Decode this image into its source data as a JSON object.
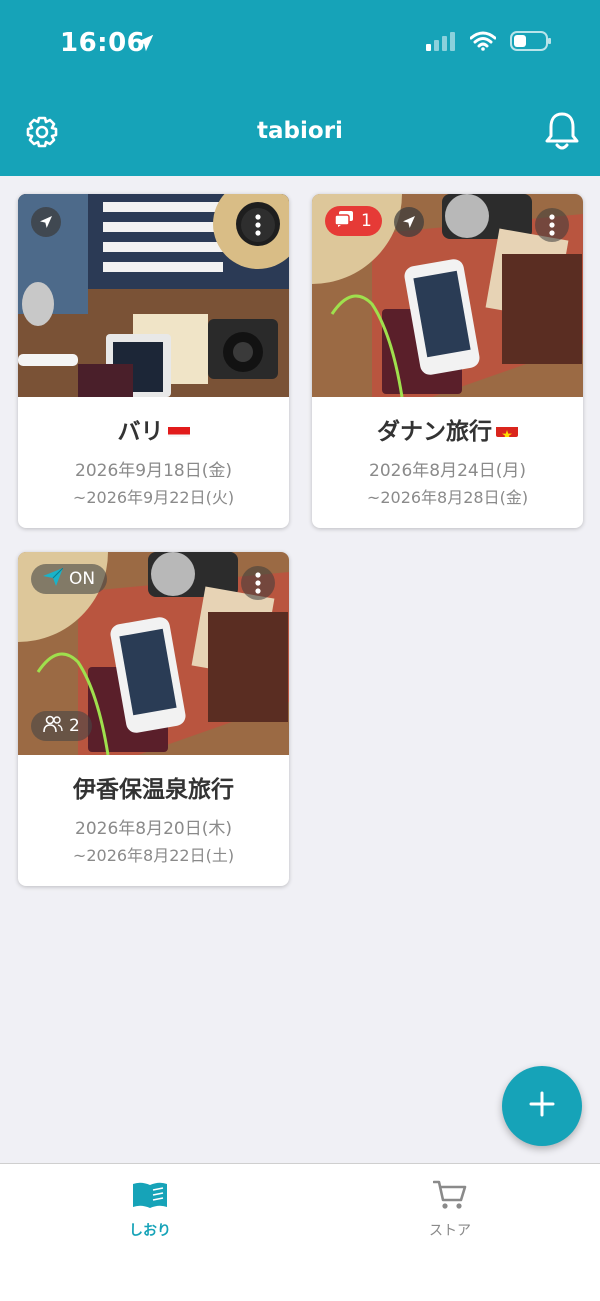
{
  "status": {
    "time": "16:06"
  },
  "header": {
    "title": "tabiori"
  },
  "trips": [
    {
      "title": "バリ",
      "flag": "indonesia-flag",
      "date_start": "2026年9月18日(金)",
      "date_end": "~2026年9月22日(火)"
    },
    {
      "title": "ダナン旅行",
      "flag": "vietnam-flag",
      "chat_count": "1",
      "date_start": "2026年8月24日(月)",
      "date_end": "~2026年8月28日(金)"
    },
    {
      "title": "伊香保温泉旅行",
      "status_label": "ON",
      "member_count": "2",
      "date_start": "2026年8月20日(木)",
      "date_end": "~2026年8月22日(土)"
    }
  ],
  "tabs": [
    {
      "label": "しおり",
      "icon": "book-icon",
      "active": true
    },
    {
      "label": "ストア",
      "icon": "cart-icon",
      "active": false
    }
  ],
  "colors": {
    "accent": "#16a3b8",
    "badge_red": "#e63a36"
  }
}
